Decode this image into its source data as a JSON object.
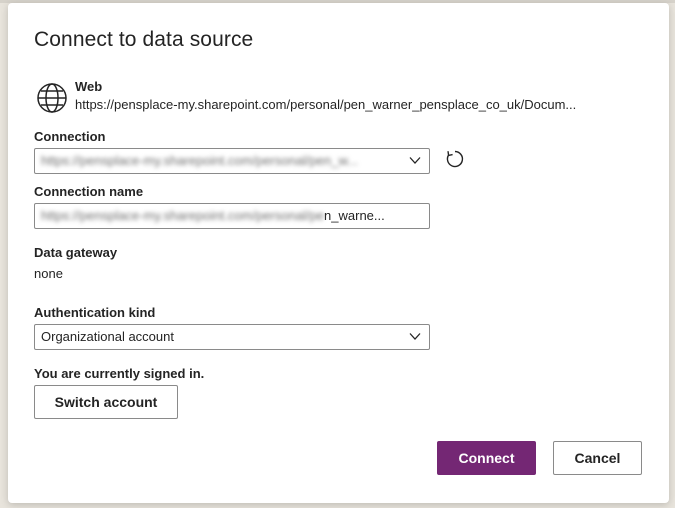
{
  "dialog": {
    "title": "Connect to data source"
  },
  "source": {
    "icon": "globe-icon",
    "type": "Web",
    "url": "https://pensplace-my.sharepoint.com/personal/pen_warner_pensplace_co_uk/Docum..."
  },
  "connection": {
    "label": "Connection",
    "value_obscured": "https://pensplace-my.sharepoint.com/personal/pen_w...",
    "value_visible_suffix": "_w..."
  },
  "connection_name": {
    "label": "Connection name",
    "value_obscured": "https://pensplace-my.sharepoint.com/personal/pe",
    "value_visible_suffix": "n_warne..."
  },
  "gateway": {
    "label": "Data gateway",
    "value": "none"
  },
  "auth": {
    "label": "Authentication kind",
    "selected": "Organizational account"
  },
  "signin": {
    "status": "You are currently signed in.",
    "switch_label": "Switch account"
  },
  "footer": {
    "connect_label": "Connect",
    "cancel_label": "Cancel"
  },
  "colors": {
    "primary": "#742774",
    "border": "#8a8a8a",
    "text": "#242424"
  }
}
